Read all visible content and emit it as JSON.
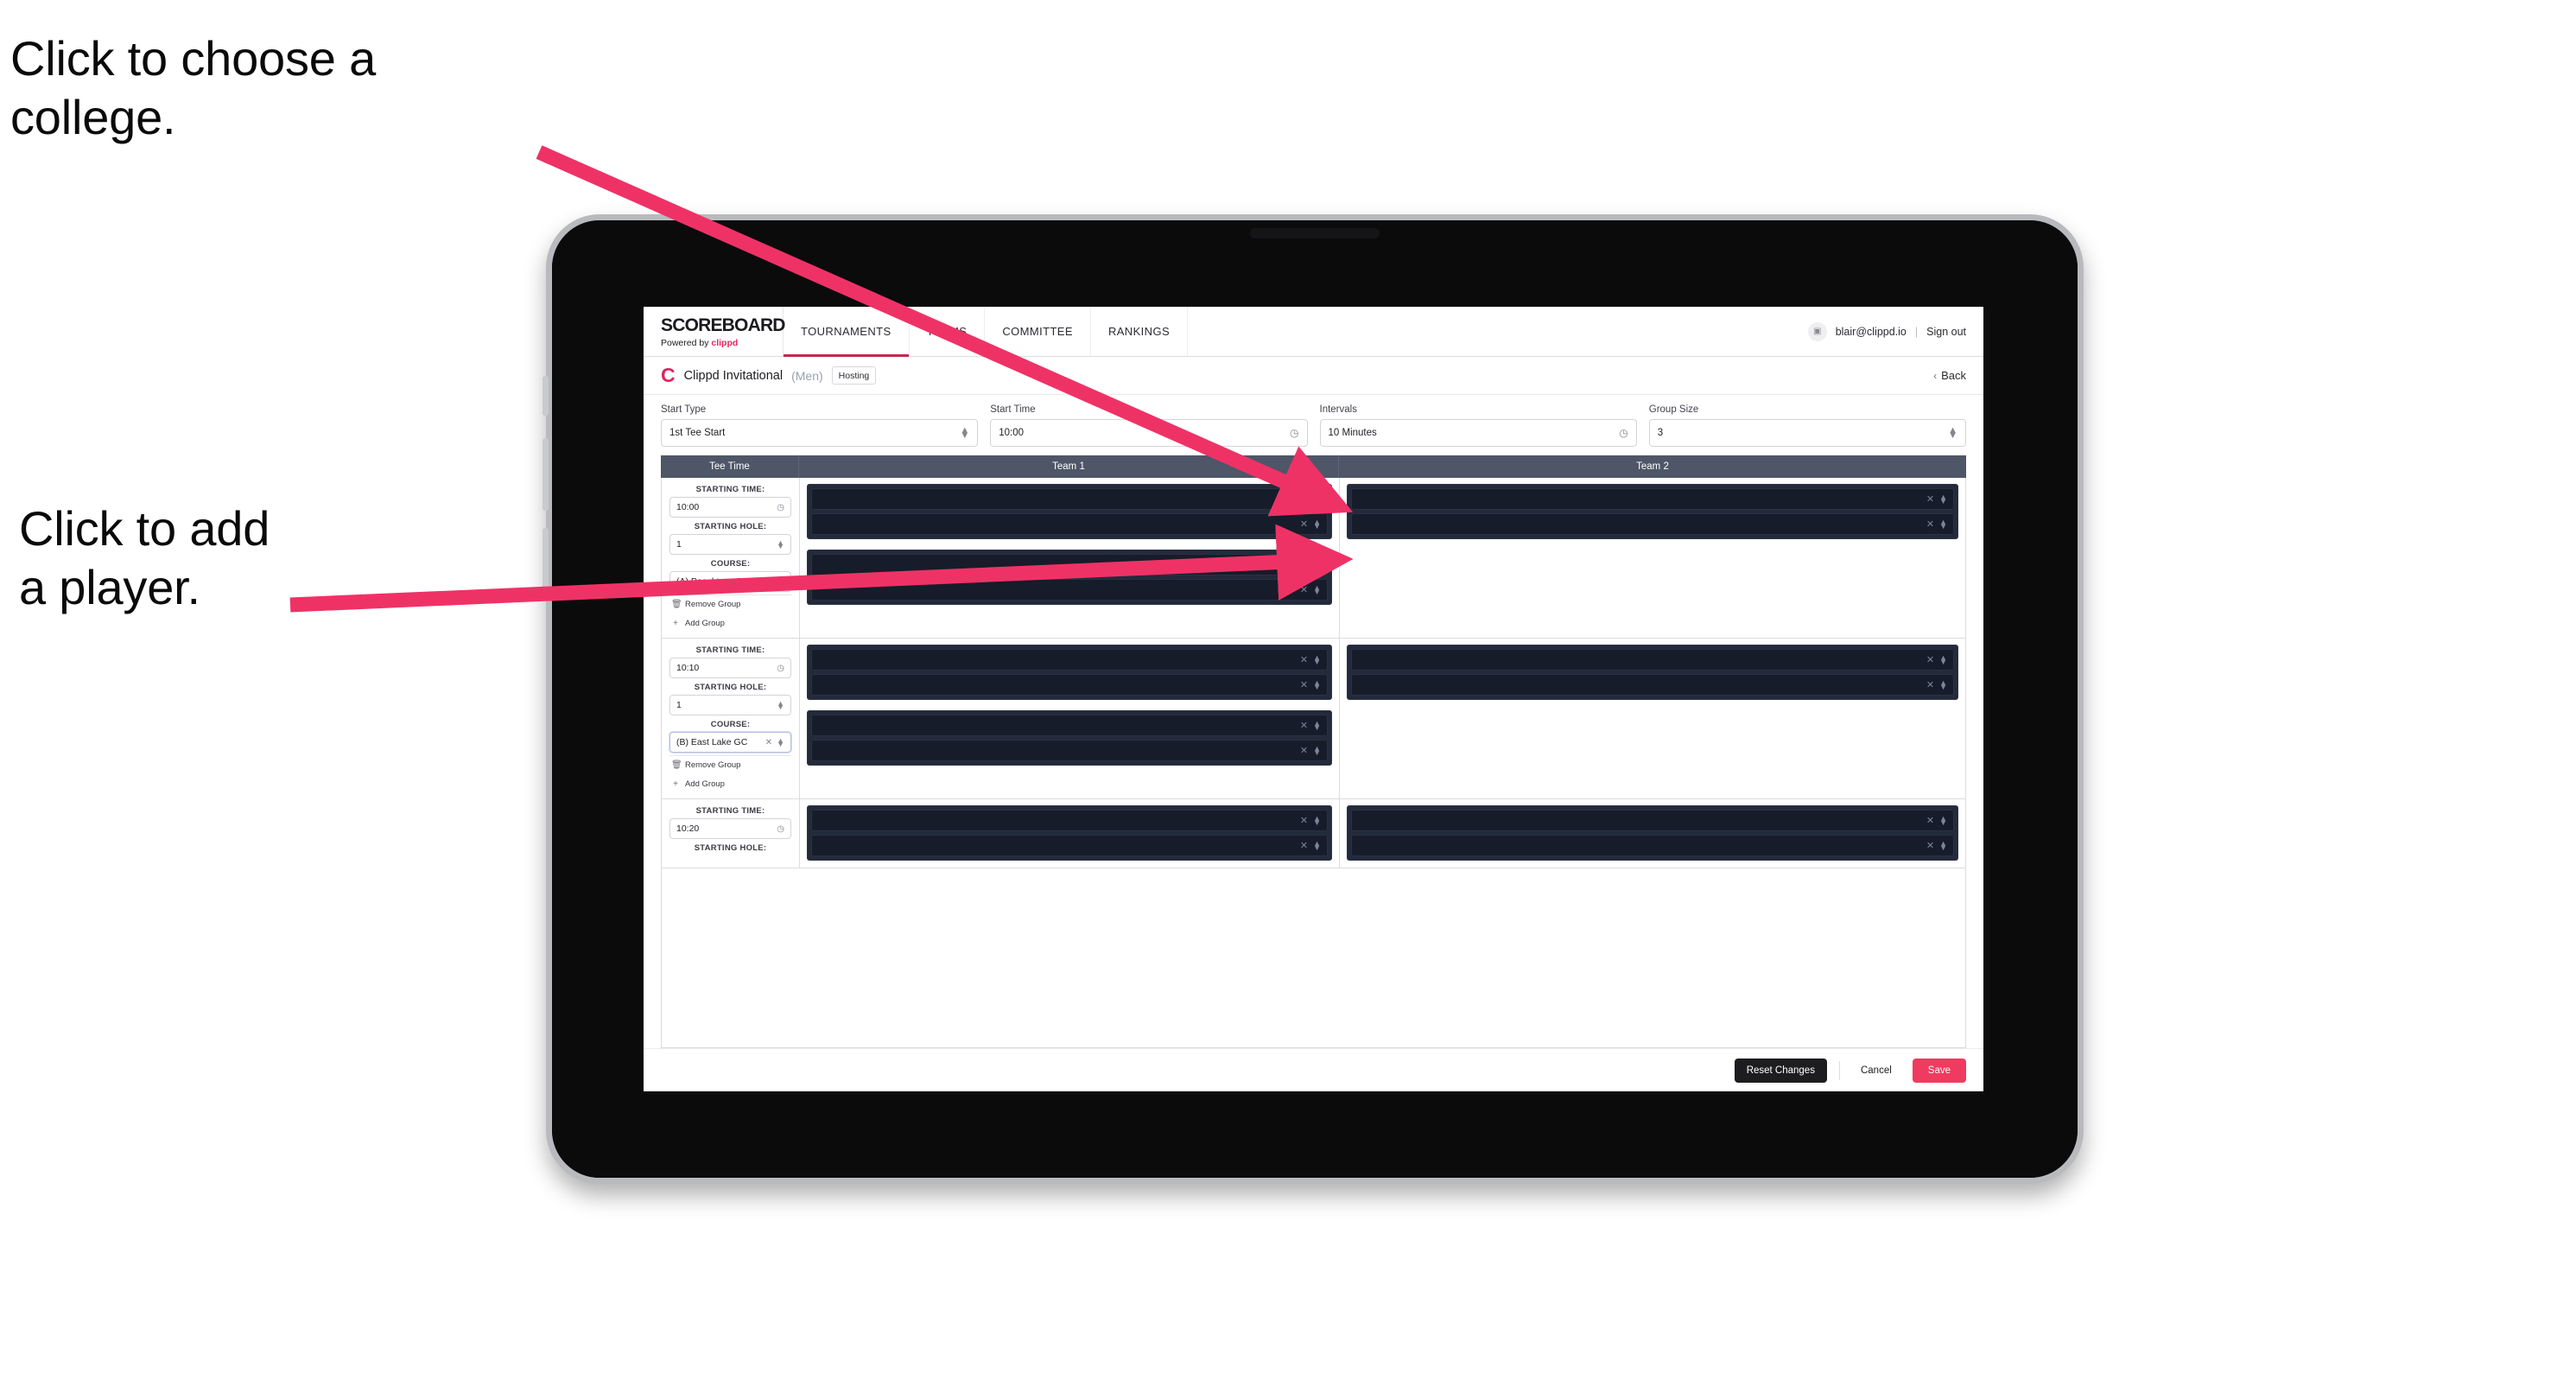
{
  "annotations": {
    "college": "Click to choose a\ncollege.",
    "player": "Click to add\na player."
  },
  "colors": {
    "accent": "#e8245c",
    "save": "#ef3b5f",
    "arrow": "#ef3266",
    "table_header": "#4e5668",
    "player_row": "#161c2a"
  },
  "topnav": {
    "brand_title": "SCOREBOARD",
    "brand_sub_prefix": "Powered by ",
    "brand_sub_accent": "clippd",
    "tabs": [
      {
        "label": "TOURNAMENTS",
        "active": true
      },
      {
        "label": "TEAMS",
        "active": false
      },
      {
        "label": "COMMITTEE",
        "active": false
      },
      {
        "label": "RANKINGS",
        "active": false
      }
    ],
    "avatar_icon": "user-avatar-icon",
    "email": "blair@clippd.io",
    "separator": "|",
    "sign_out": "Sign out"
  },
  "titlebar": {
    "logo_letter": "C",
    "tournament_name": "Clippd Invitational",
    "gender": "(Men)",
    "badge": "Hosting",
    "back_label": "Back",
    "back_icon": "chevron-left-icon"
  },
  "controls": [
    {
      "label": "Start Type",
      "value": "1st Tee Start",
      "icon": "stepper-icon"
    },
    {
      "label": "Start Time",
      "value": "10:00",
      "icon": "clock-icon"
    },
    {
      "label": "Intervals",
      "value": "10 Minutes",
      "icon": "clock-icon"
    },
    {
      "label": "Group Size",
      "value": "3",
      "icon": "stepper-icon"
    }
  ],
  "table": {
    "headers": [
      "Tee Time",
      "Team 1",
      "Team 2"
    ],
    "labels": {
      "starting_time": "STARTING TIME:",
      "starting_hole": "STARTING HOLE:",
      "course": "COURSE:",
      "remove_group": "Remove Group",
      "add_group": "Add Group"
    },
    "icons": {
      "clock": "clock-icon",
      "stepper": "stepper-icon",
      "clear": "clear-x-icon",
      "trash": "trash-icon",
      "plus": "plus-icon"
    },
    "rows": [
      {
        "starting_time": "10:00",
        "starting_hole": "1",
        "course": "(A) Peachtree GC",
        "course_focused": false,
        "team1_blocks": [
          {
            "players": [
              "",
              ""
            ]
          },
          {
            "players": [
              "",
              ""
            ]
          }
        ],
        "team2_blocks": [
          {
            "players": [
              "",
              ""
            ]
          }
        ]
      },
      {
        "starting_time": "10:10",
        "starting_hole": "1",
        "course": "(B) East Lake GC",
        "course_focused": true,
        "team1_blocks": [
          {
            "players": [
              "",
              ""
            ]
          },
          {
            "players": [
              "",
              ""
            ]
          }
        ],
        "team2_blocks": [
          {
            "players": [
              "",
              ""
            ]
          }
        ]
      },
      {
        "starting_time": "10:20",
        "starting_hole": "",
        "course": "",
        "course_focused": false,
        "team1_blocks": [
          {
            "players": [
              "",
              ""
            ]
          }
        ],
        "team2_blocks": [
          {
            "players": [
              "",
              ""
            ]
          }
        ]
      }
    ]
  },
  "footer": {
    "reset": "Reset Changes",
    "cancel": "Cancel",
    "save": "Save"
  }
}
